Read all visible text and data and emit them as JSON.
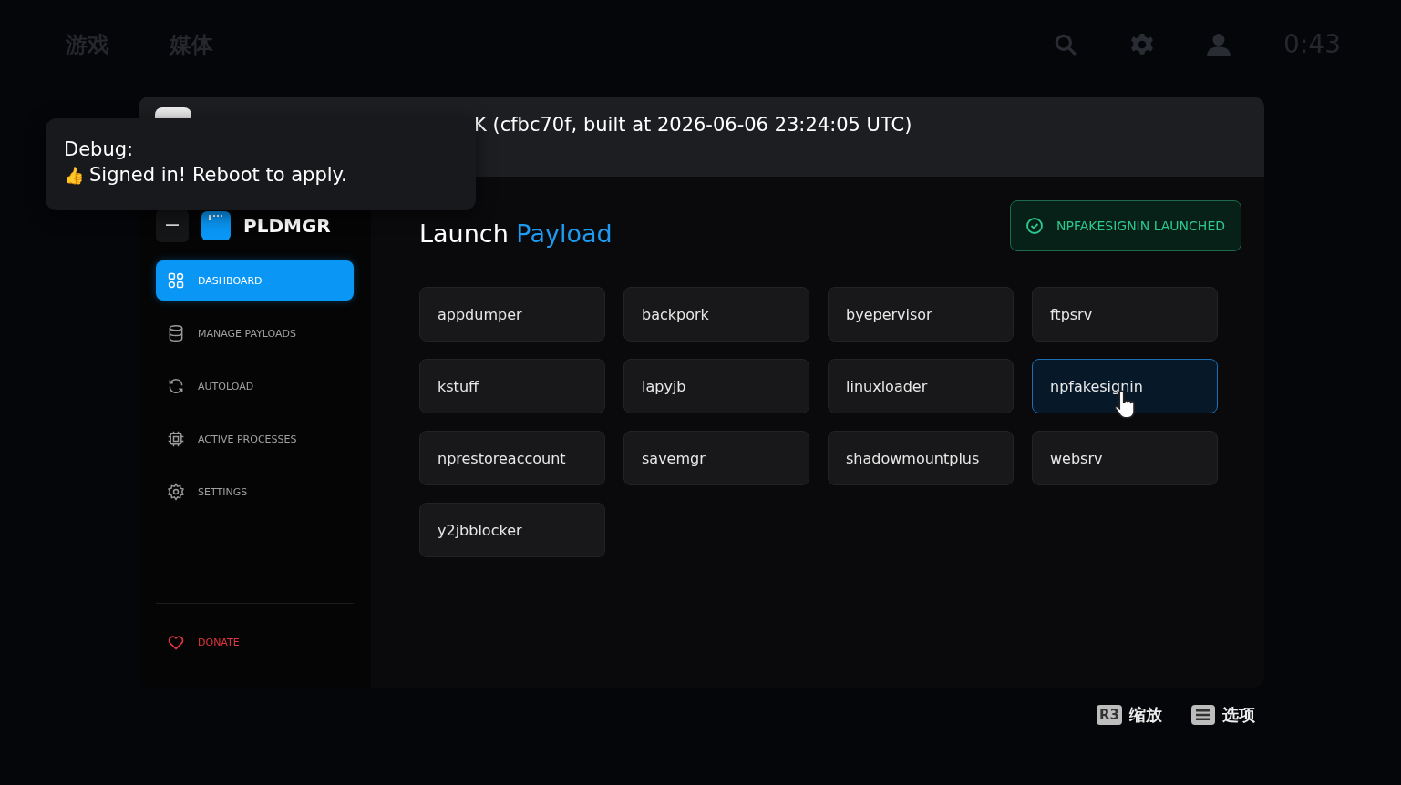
{
  "top_bar": {
    "tabs": [
      {
        "label": "游戏",
        "selected": false
      },
      {
        "label": "媒体",
        "selected": false
      }
    ],
    "time": "0:43"
  },
  "header": {
    "title": "K (cfbc70f, built at 2026-06-06 23:24:05 UTC)"
  },
  "sidebar": {
    "app_name": "PLDMGR",
    "items": [
      {
        "label": "DASHBOARD",
        "selected": true
      },
      {
        "label": "MANAGE PAYLOADS",
        "selected": false
      },
      {
        "label": "AUTOLOAD",
        "selected": false
      },
      {
        "label": "ACTIVE PROCESSES",
        "selected": false
      },
      {
        "label": "SETTINGS",
        "selected": false
      }
    ],
    "footer_item": {
      "label": "DONATE"
    }
  },
  "main": {
    "title": "Launch **Payload**",
    "status_badge": "NPFAKESIGNIN LAUNCHED",
    "payloads": [
      {
        "label": "appdumper",
        "selected": false
      },
      {
        "label": "backpork",
        "selected": false
      },
      {
        "label": "byepervisor",
        "selected": false
      },
      {
        "label": "ftpsrv",
        "selected": false
      },
      {
        "label": "kstuff",
        "selected": false
      },
      {
        "label": "lapyjb",
        "selected": false
      },
      {
        "label": "linuxloader",
        "selected": false
      },
      {
        "label": "npfakesignin",
        "selected": true
      },
      {
        "label": "nprestoreaccount",
        "selected": false
      },
      {
        "label": "savemgr",
        "selected": false
      },
      {
        "label": "shadowmountplus",
        "selected": false
      },
      {
        "label": "websrv",
        "selected": false
      },
      {
        "label": "y2jbblocker",
        "selected": false
      }
    ]
  },
  "toast": {
    "title": "Debug:",
    "emoji": "👍",
    "message": "Signed in! Reboot to apply."
  },
  "hints": [
    {
      "key": "R3",
      "label": "缩放",
      "kind": "key"
    },
    {
      "label": "选项",
      "kind": "menu"
    }
  ]
}
